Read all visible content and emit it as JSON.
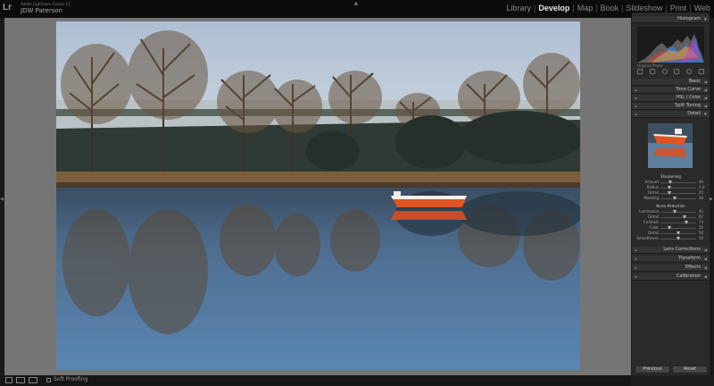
{
  "app": {
    "name": "Adobe Lightroom Classic CC",
    "user": "JDW Paterson"
  },
  "modules": [
    {
      "label": "Library",
      "active": false
    },
    {
      "label": "Develop",
      "active": true
    },
    {
      "label": "Map",
      "active": false
    },
    {
      "label": "Book",
      "active": false
    },
    {
      "label": "Slideshow",
      "active": false
    },
    {
      "label": "Print",
      "active": false
    },
    {
      "label": "Web",
      "active": false
    }
  ],
  "toolbar": {
    "soft_proofing": "Soft Proofing"
  },
  "panel": {
    "histogram": "Histogram",
    "original_photo": "Original Photo",
    "basic": "Basic",
    "tone_curve": "Tone Curve",
    "hsl": "HSL / Color",
    "split_toning": "Split Toning",
    "detail": "Detail",
    "sharpening": {
      "title": "Sharpening",
      "sliders": [
        {
          "label": "Amount",
          "value": "40",
          "level": 0.27
        },
        {
          "label": "Radius",
          "value": "1.0",
          "level": 0.25
        },
        {
          "label": "Detail",
          "value": "25",
          "level": 0.25
        },
        {
          "label": "Masking",
          "value": "40",
          "level": 0.4
        }
      ]
    },
    "noise_reduction": {
      "title": "Noise Reduction",
      "sliders": [
        {
          "label": "Luminance",
          "value": "41",
          "level": 0.41
        },
        {
          "label": "Detail",
          "value": "67",
          "level": 0.67
        },
        {
          "label": "Contrast",
          "value": "73",
          "level": 0.73
        },
        {
          "label": "Color",
          "value": "25",
          "level": 0.25
        },
        {
          "label": "Detail",
          "value": "50",
          "level": 0.5
        },
        {
          "label": "Smoothness",
          "value": "50",
          "level": 0.5
        }
      ]
    },
    "lens_corrections": "Lens Corrections",
    "transform": "Transform",
    "effects": "Effects",
    "calibration": "Calibration"
  },
  "buttons": {
    "previous": "Previous",
    "reset": "Reset"
  }
}
